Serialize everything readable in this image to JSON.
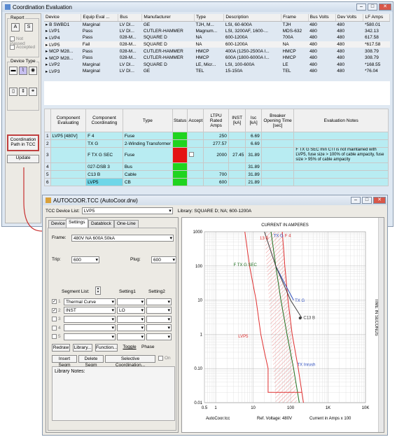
{
  "app": {
    "title": "Coordination Evaluation"
  },
  "tcc_window": {
    "title": "AUTOCOOR.TCC (AutoCoor.drw)"
  },
  "left": {
    "report_label": "Report",
    "btn_a": "A",
    "btn_s": "S",
    "not_passed": "Not Passed",
    "accepted": "Accepted",
    "device_type_label": "Device Type",
    "coord_path_btn": "Coordination Path in TCC",
    "update_btn": "Update"
  },
  "devices": {
    "columns": [
      "Device",
      "Equip Eval ...",
      "Bus",
      "Manufacturer",
      "Type",
      "Description",
      "Frame",
      "Bus Volts",
      "Dev Volts",
      "LF Amps"
    ],
    "rows": [
      [
        "B SWBD1",
        "Marginal",
        "LV DI...",
        "GE",
        "TJH, M...",
        "LSI, 60-600A",
        "TJH",
        "480",
        "480",
        "*580.01"
      ],
      [
        "LVP1",
        "Pass",
        "LV DI...",
        "CUTLER-HAMMER",
        "Magnum...",
        "LSI, 3200AF, 1600-...",
        "MDS-632",
        "480",
        "480",
        "342.13"
      ],
      [
        "LVP4",
        "Pass",
        "028-M...",
        "SQUARE D",
        "NA",
        "600-1200A",
        "700A",
        "480",
        "480",
        "617.58"
      ],
      [
        "LVP5",
        "Fail",
        "028-M...",
        "SQUARE D",
        "NA",
        "600-1200A",
        "NA",
        "480",
        "480",
        "*617.58"
      ],
      [
        "MCP M28...",
        "Pass",
        "028-M...",
        "CUTLER-HAMMER",
        "HMCP",
        "400A (1250-2500A I...",
        "HMCP",
        "480",
        "480",
        "308.79"
      ],
      [
        "MCP M28...",
        "Pass",
        "028-M...",
        "CUTLER-HAMMER",
        "HMCP",
        "600A (1800-6000A I...",
        "HMCP",
        "480",
        "480",
        "308.79"
      ],
      [
        "LVP2",
        "Marginal",
        "LV DI...",
        "SQUARE D",
        "LE, Micr...",
        "LSI, 100-600A",
        "LE",
        "480",
        "480",
        "*168.55"
      ],
      [
        "LVP3",
        "Marginal",
        "LV DI...",
        "GE",
        "TEL",
        "15-150A",
        "TEL",
        "480",
        "480",
        "*76.04"
      ]
    ]
  },
  "evaluation": {
    "columns": [
      "",
      "Component Evaluating",
      "Component Coordinating",
      "Type",
      "Status",
      "Accept",
      "LTPU Rated Amps",
      "INST [kA]",
      "Isc [kA]",
      "Breaker Opening Time [sec]",
      "Evaluation Notes"
    ],
    "rows": [
      {
        "n": "1",
        "eval": "LVP5 [480V]",
        "coord": "F 4",
        "type": "Fuse",
        "status": "green",
        "ltpu": "250",
        "inst": "",
        "isc": "6.69",
        "bot": "",
        "note": ""
      },
      {
        "n": "2",
        "eval": "",
        "coord": "TX G",
        "type": "2-Winding Transformer",
        "status": "green",
        "ltpu": "277.57",
        "inst": "",
        "isc": "6.69",
        "bot": "",
        "note": ""
      },
      {
        "n": "3",
        "eval": "",
        "coord": "F TX G SEC",
        "type": "Fuse",
        "status": "red",
        "ltpu": "2000",
        "inst": "27.45",
        "isc": "31.89",
        "bot": "",
        "note": "F TX G SEC min CTI is not maintained with LVP5, fuse size > 100% of cable ampacity, fuse size > 95% of cable ampacity"
      },
      {
        "n": "4",
        "eval": "",
        "coord": "027-DSB 3",
        "type": "Bus",
        "status": "green",
        "ltpu": "",
        "inst": "",
        "isc": "31.89",
        "bot": "",
        "note": ""
      },
      {
        "n": "5",
        "eval": "",
        "coord": "C13 B",
        "type": "Cable",
        "status": "green",
        "ltpu": "700",
        "inst": "",
        "isc": "31.89",
        "bot": "",
        "note": ""
      },
      {
        "n": "6",
        "eval": "",
        "coord": "LVP5",
        "type": "CB",
        "status": "green",
        "ltpu": "600",
        "inst": "",
        "isc": "21.89",
        "bot": "",
        "note": ""
      }
    ]
  },
  "tcc": {
    "device_list_label": "TCC Device List:",
    "device_list_value": "LVP5",
    "library": "Library:   SQUARE D; NA; 600-1200A",
    "tabs": [
      "Device",
      "Settings",
      "Datablock",
      "One-Line"
    ],
    "frame_label": "Frame:",
    "frame_value": "480V  NA  600A 50kA",
    "trip_label": "Trip:",
    "trip_value": "600",
    "plug_label": "Plug:",
    "plug_value": "600",
    "segment_list_label": "Segment List:",
    "setting1_label": "Setting1",
    "setting2_label": "Setting2",
    "segments": [
      {
        "n": "1",
        "name": "Thermal Curve",
        "s1": "",
        "s2": "",
        "checked": true
      },
      {
        "n": "2",
        "name": "INST",
        "s1": "LO",
        "s2": "",
        "checked": true
      },
      {
        "n": "3",
        "name": "",
        "s1": "",
        "s2": "",
        "checked": false
      },
      {
        "n": "4",
        "name": "",
        "s1": "",
        "s2": "",
        "checked": false
      },
      {
        "n": "5",
        "name": "",
        "s1": "",
        "s2": "",
        "checked": false
      }
    ],
    "buttons": {
      "redraw": "Redraw",
      "library": "Library...",
      "function": "Function...",
      "toggle": "Toggle",
      "phase": "Phase",
      "insert": "Insert Segm",
      "delete": "Delete Segm",
      "selective": "Selective Coordination...",
      "on": "On"
    },
    "library_notes_label": "Library Notes:"
  },
  "chart_data": {
    "type": "line",
    "title": "CURRENT IN AMPERES",
    "ylabel": "TIME IN SECONDS",
    "xlabel": "Current in Amps x 100",
    "footer_left": "AutoCoor.tcc",
    "footer_mid": "Ref. Voltage: 480V",
    "x_ticks": [
      "0.5",
      "1",
      "10",
      "100",
      "1K",
      "10K"
    ],
    "y_ticks": [
      "1000",
      "100",
      "10",
      "1",
      "0.10",
      "0.01"
    ],
    "xlim": [
      0.5,
      10000
    ],
    "ylim": [
      0.01,
      1000
    ],
    "series": [
      {
        "name": "F 4",
        "color": "#e03030",
        "points": [
          [
            60,
            1000
          ],
          [
            70,
            100
          ],
          [
            85,
            10
          ],
          [
            110,
            1
          ],
          [
            160,
            0.1
          ],
          [
            220,
            0.01
          ]
        ]
      },
      {
        "name": "F TX G SEC",
        "color": "#207020",
        "points": [
          [
            30,
            1000
          ],
          [
            40,
            100
          ],
          [
            55,
            10
          ],
          [
            80,
            1
          ],
          [
            120,
            0.1
          ],
          [
            170,
            0.01
          ]
        ]
      },
      {
        "name": "LVP5",
        "color": "#e03030",
        "points": [
          [
            6,
            1000
          ],
          [
            8,
            100
          ],
          [
            12,
            10
          ],
          [
            16,
            1
          ],
          [
            20,
            0.3
          ],
          [
            25,
            0.1
          ],
          [
            25,
            0.02
          ],
          [
            200,
            0.02
          ]
        ]
      },
      {
        "name": "TX G",
        "color": "#3050c0",
        "points": [
          [
            40,
            100
          ],
          [
            70,
            30
          ],
          [
            120,
            10
          ]
        ]
      },
      {
        "name": "C13 B",
        "color": "#404040",
        "points": [
          [
            20,
            1000
          ],
          [
            40,
            100
          ],
          [
            100,
            10
          ],
          [
            200,
            3
          ]
        ]
      }
    ],
    "annotations": [
      "F 4",
      "13 B",
      "TX G",
      "F TX G SEC",
      "TX G",
      "C13 B",
      "LVP5",
      "TX Inrush"
    ]
  }
}
